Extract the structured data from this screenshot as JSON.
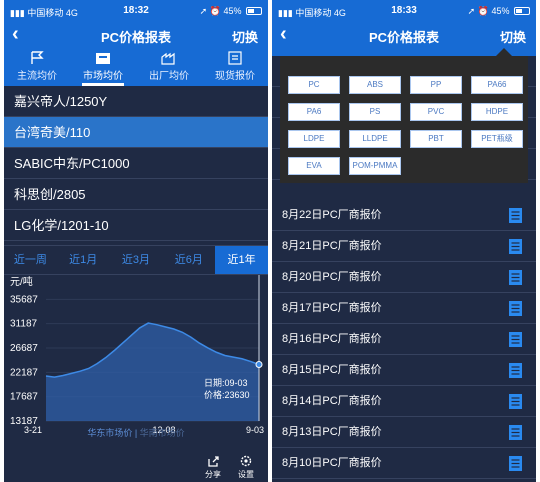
{
  "status": {
    "carrier": "中国移动",
    "network": "4G",
    "battery": "45%"
  },
  "left": {
    "time": "18:32",
    "title": "PC价格报表",
    "switch_label": "切换",
    "tabs": [
      {
        "label": "主流均价"
      },
      {
        "label": "市场均价"
      },
      {
        "label": "出厂均价"
      },
      {
        "label": "现货报价"
      }
    ],
    "active_tab": 1,
    "products": [
      "嘉兴帝人/1250Y",
      "台湾奇美/110",
      "SABIC中东/PC1000",
      "科思创/2805",
      "LG化学/1201-10"
    ],
    "selected_product": 1,
    "periods": [
      "近一周",
      "近1月",
      "近3月",
      "近6月",
      "近1年"
    ],
    "active_period": 4,
    "chart_data": {
      "type": "area",
      "ylabel": "元/吨",
      "yticks": [
        13187,
        17687,
        22187,
        26687,
        31187,
        35687
      ],
      "ylim": [
        13187,
        40187
      ],
      "xticks": [
        "3-21",
        "12-08",
        "9-03"
      ],
      "x": [
        0,
        4,
        8,
        12,
        16,
        20,
        24,
        28,
        32,
        36,
        40,
        44,
        48,
        52,
        56,
        60,
        64,
        68,
        72,
        76,
        80,
        84,
        88,
        92,
        96,
        100
      ],
      "values": [
        21500,
        21300,
        21600,
        22000,
        22400,
        22900,
        23800,
        24900,
        26200,
        27600,
        29000,
        30400,
        31300,
        31000,
        30600,
        30200,
        29600,
        28700,
        27600,
        26700,
        25900,
        25300,
        25000,
        24700,
        24200,
        23630
      ],
      "tooltip_date": "日期:09-03",
      "tooltip_price": "价格:23630",
      "legend": [
        "华东市场价",
        "华南市场价"
      ]
    },
    "share_label": "分享",
    "settings_label": "设置"
  },
  "right": {
    "time": "18:33",
    "title": "PC价格报表",
    "switch_label": "切换",
    "materials": [
      "PC",
      "ABS",
      "PP",
      "PA66",
      "PA6",
      "PS",
      "PVC",
      "HDPE",
      "LDPE",
      "LLDPE",
      "PBT",
      "PET瓶级",
      "EVA",
      "POM-PMMA"
    ],
    "reports": [
      "8月22日PC厂商报价",
      "8月21日PC厂商报价",
      "8月20日PC厂商报价",
      "8月17日PC厂商报价",
      "8月16日PC厂商报价",
      "8月15日PC厂商报价",
      "8月14日PC厂商报价",
      "8月13日PC厂商报价",
      "8月10日PC厂商报价"
    ],
    "colors": {
      "accent": "#176bd4",
      "doc_icon": "#2a8af0"
    }
  }
}
